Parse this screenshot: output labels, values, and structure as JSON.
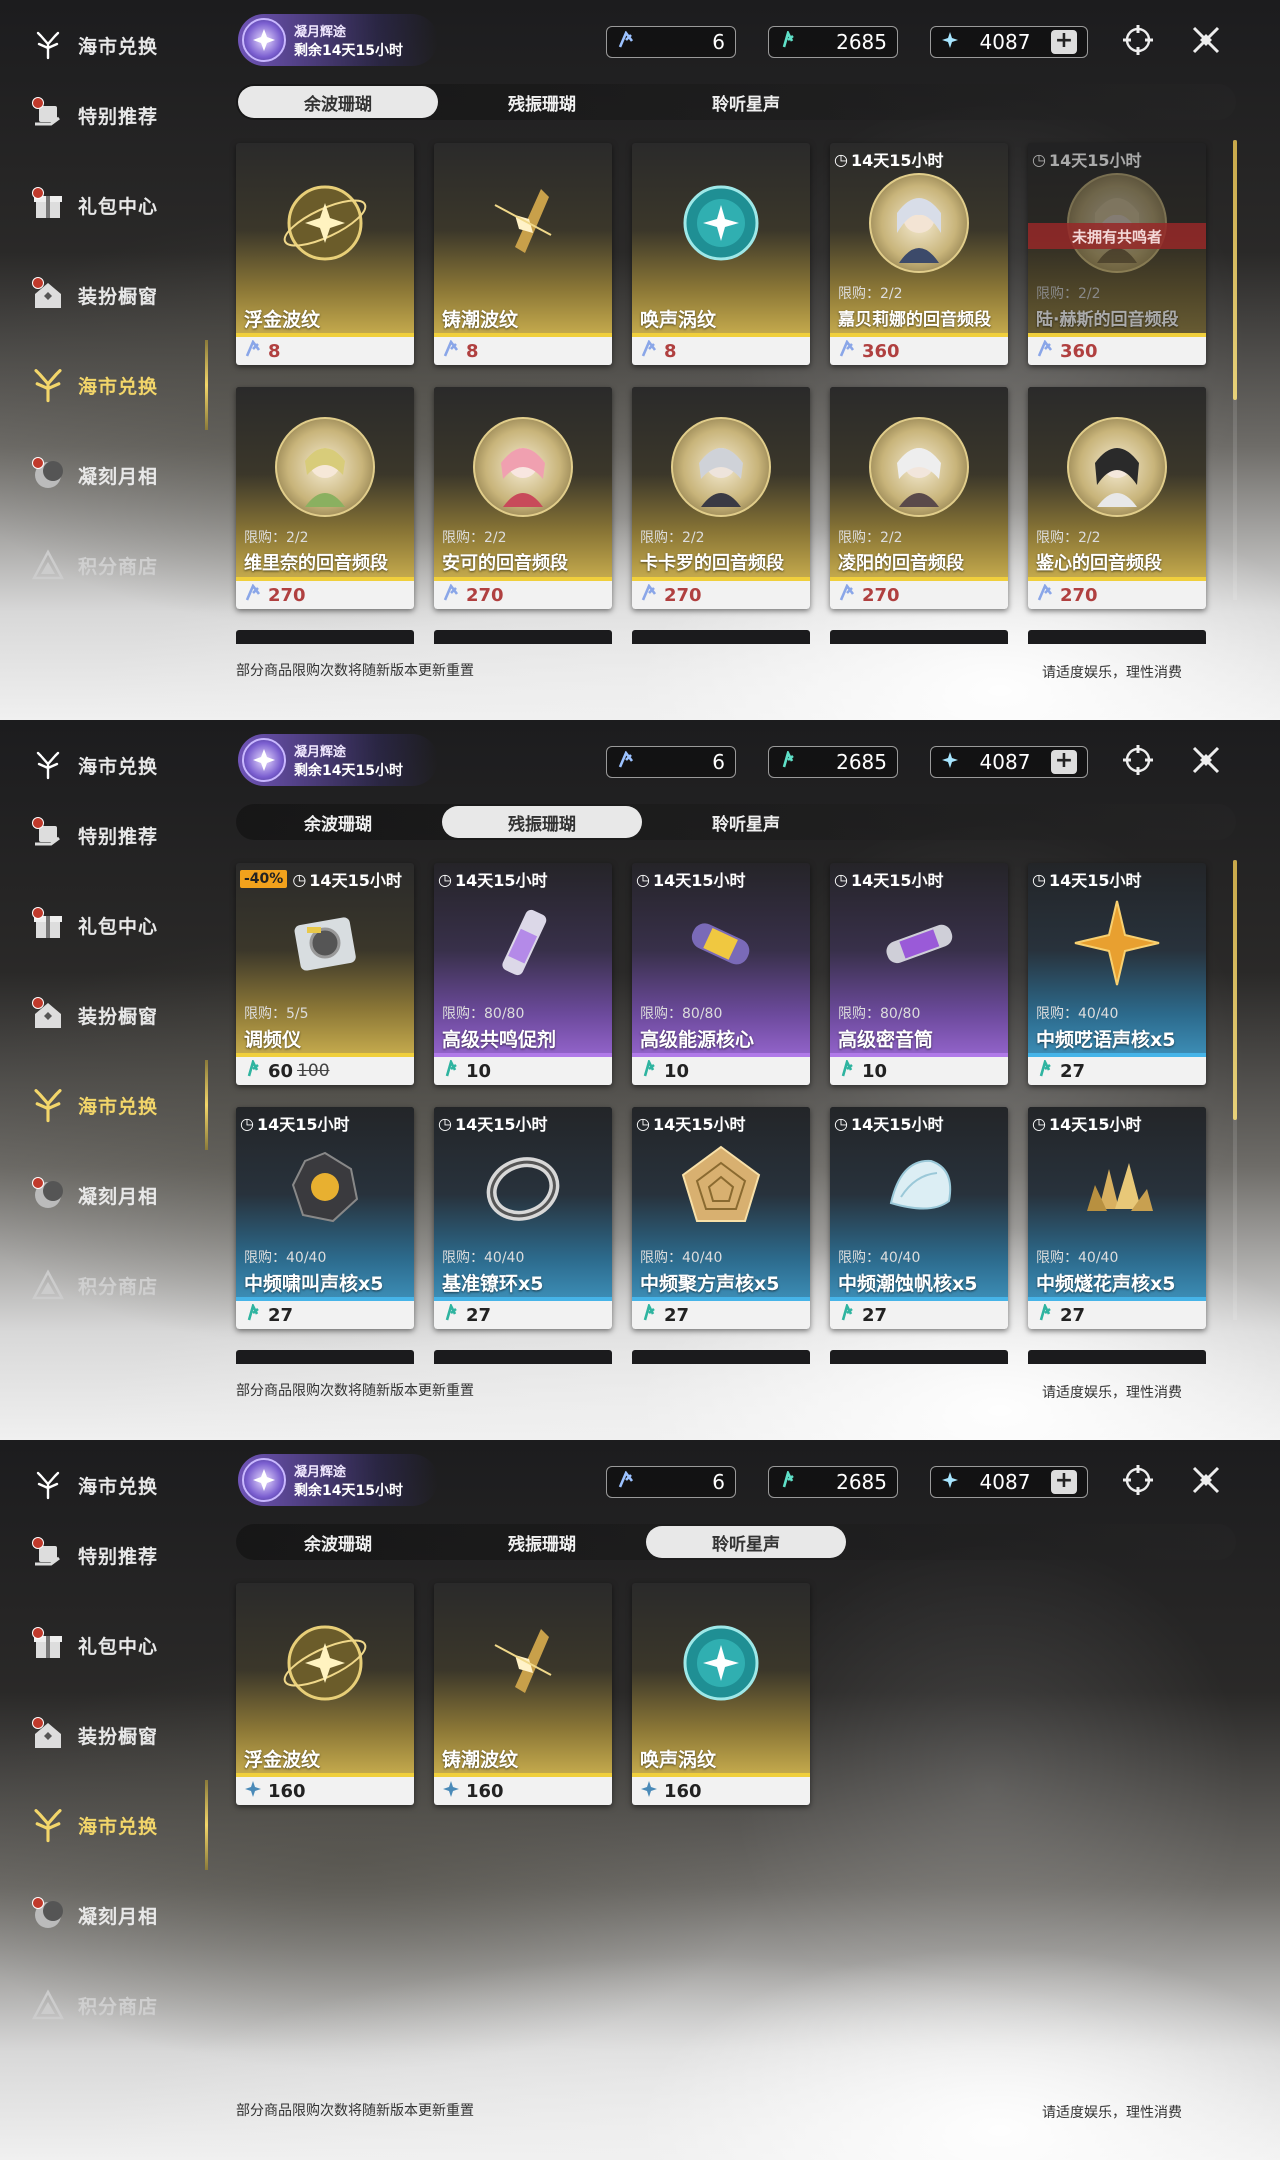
{
  "header": {
    "event_title": "凝月辉途",
    "event_time": "剩余14天15小时",
    "currencies": [
      {
        "name": "coral-afterglow",
        "value": "6",
        "color": "#9cc2ff"
      },
      {
        "name": "coral-oscillate",
        "value": "2685",
        "color": "#5fe0c8"
      },
      {
        "name": "astrite",
        "value": "4087",
        "color": "#a8e6ff"
      }
    ],
    "plus_label": "+"
  },
  "sidebar": {
    "items": [
      {
        "label": "海市兑换",
        "icon": "coral-tree-icon"
      },
      {
        "label": "特别推荐",
        "icon": "hand-gift-icon"
      },
      {
        "label": "礼包中心",
        "icon": "gift-box-icon"
      },
      {
        "label": "装扮橱窗",
        "icon": "house-icon"
      },
      {
        "label": "海市兑换",
        "icon": "coral-tree-icon"
      },
      {
        "label": "凝刻月相",
        "icon": "moon-icon"
      },
      {
        "label": "积分商店",
        "icon": "triangle-icon"
      }
    ]
  },
  "tabs": [
    "余波珊瑚",
    "残振珊瑚",
    "聆听星声"
  ],
  "footer": {
    "note": "部分商品限购次数将随新版本更新重置",
    "advice": "请适度娱乐，理性消费"
  },
  "panel1": {
    "row1": [
      {
        "name": "浮金波纹",
        "price": "8",
        "timer": "",
        "limit": "",
        "banner": ""
      },
      {
        "name": "铸潮波纹",
        "price": "8",
        "timer": "",
        "limit": "",
        "banner": ""
      },
      {
        "name": "唤声涡纹",
        "price": "8",
        "timer": "",
        "limit": "",
        "banner": ""
      },
      {
        "name": "嘉贝莉娜的回音频段",
        "price": "360",
        "timer": "14天15小时",
        "limit": "限购：2/2",
        "banner": ""
      },
      {
        "name": "陆·赫斯的回音频段",
        "price": "360",
        "timer": "14天15小时",
        "limit": "限购：2/2",
        "banner": "未拥有共鸣者"
      }
    ],
    "row2": [
      {
        "name": "维里奈的回音频段",
        "price": "270",
        "limit": "限购：2/2"
      },
      {
        "name": "安可的回音频段",
        "price": "270",
        "limit": "限购：2/2"
      },
      {
        "name": "卡卡罗的回音频段",
        "price": "270",
        "limit": "限购：2/2"
      },
      {
        "name": "凌阳的回音频段",
        "price": "270",
        "limit": "限购：2/2"
      },
      {
        "name": "鉴心的回音频段",
        "price": "270",
        "limit": "限购：2/2"
      }
    ]
  },
  "panel2": {
    "row1": [
      {
        "name": "调频仪",
        "price": "60",
        "old_price": "100",
        "discount": "-40%",
        "timer": "14天15小时",
        "limit": "限购：5/5"
      },
      {
        "name": "高级共鸣促剂",
        "price": "10",
        "timer": "14天15小时",
        "limit": "限购：80/80"
      },
      {
        "name": "高级能源核心",
        "price": "10",
        "timer": "14天15小时",
        "limit": "限购：80/80"
      },
      {
        "name": "高级密音筒",
        "price": "10",
        "timer": "14天15小时",
        "limit": "限购：80/80"
      },
      {
        "name": "中频呓语声核x5",
        "price": "27",
        "timer": "14天15小时",
        "limit": "限购：40/40"
      }
    ],
    "row2": [
      {
        "name": "中频啸叫声核x5",
        "price": "27",
        "timer": "14天15小时",
        "limit": "限购：40/40"
      },
      {
        "name": "基准镣环x5",
        "price": "27",
        "timer": "14天15小时",
        "limit": "限购：40/40"
      },
      {
        "name": "中频聚方声核x5",
        "price": "27",
        "timer": "14天15小时",
        "limit": "限购：40/40"
      },
      {
        "name": "中频潮蚀帆核x5",
        "price": "27",
        "timer": "14天15小时",
        "limit": "限购：40/40"
      },
      {
        "name": "中频燧花声核x5",
        "price": "27",
        "timer": "14天15小时",
        "limit": "限购：40/40"
      }
    ]
  },
  "panel3": {
    "row1": [
      {
        "name": "浮金波纹",
        "price": "160"
      },
      {
        "name": "铸潮波纹",
        "price": "160"
      },
      {
        "name": "唤声涡纹",
        "price": "160"
      }
    ]
  }
}
